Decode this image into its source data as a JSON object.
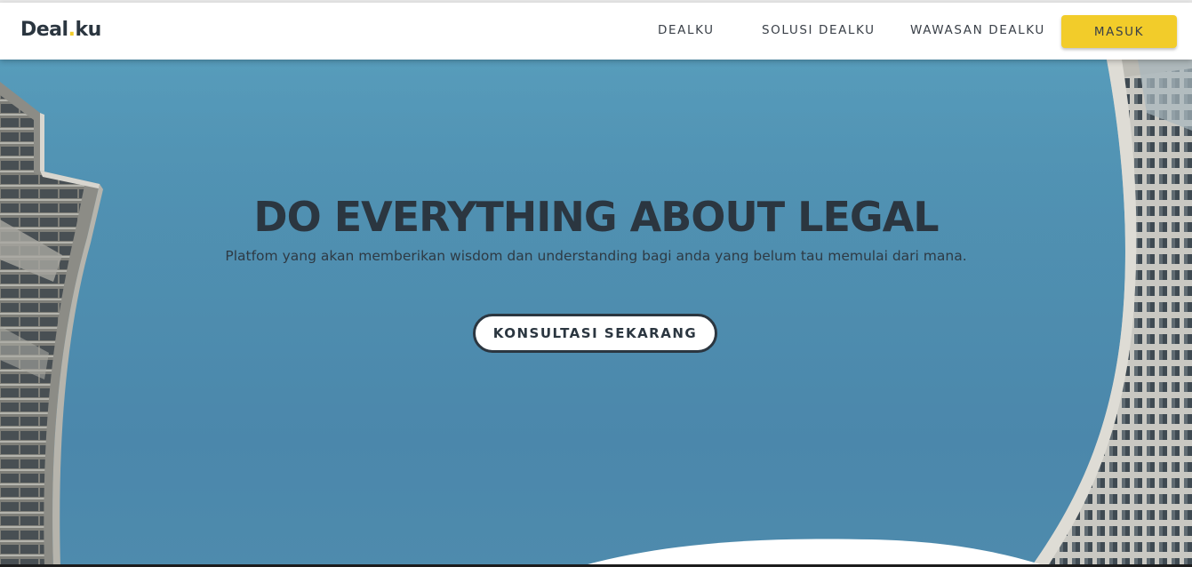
{
  "brand": {
    "logo_main": "Deal",
    "logo_dot": ".",
    "logo_suffix": "ku",
    "accent_color": "#f2cc2a"
  },
  "nav": {
    "items": [
      {
        "label": "DEALKU"
      },
      {
        "label": "SOLUSI DEALKU"
      },
      {
        "label": "WAWASAN DEALKU"
      }
    ],
    "login_label": "MASUK"
  },
  "hero": {
    "title": "DO EVERYTHING ABOUT LEGAL",
    "subtitle": "Platfom yang akan memberikan wisdom dan understanding bagi anda yang belum tau memulai dari mana.",
    "cta_label": "KONSULTASI SEKARANG",
    "sky_color": "#4f8fb0",
    "text_color": "#2b3640"
  }
}
